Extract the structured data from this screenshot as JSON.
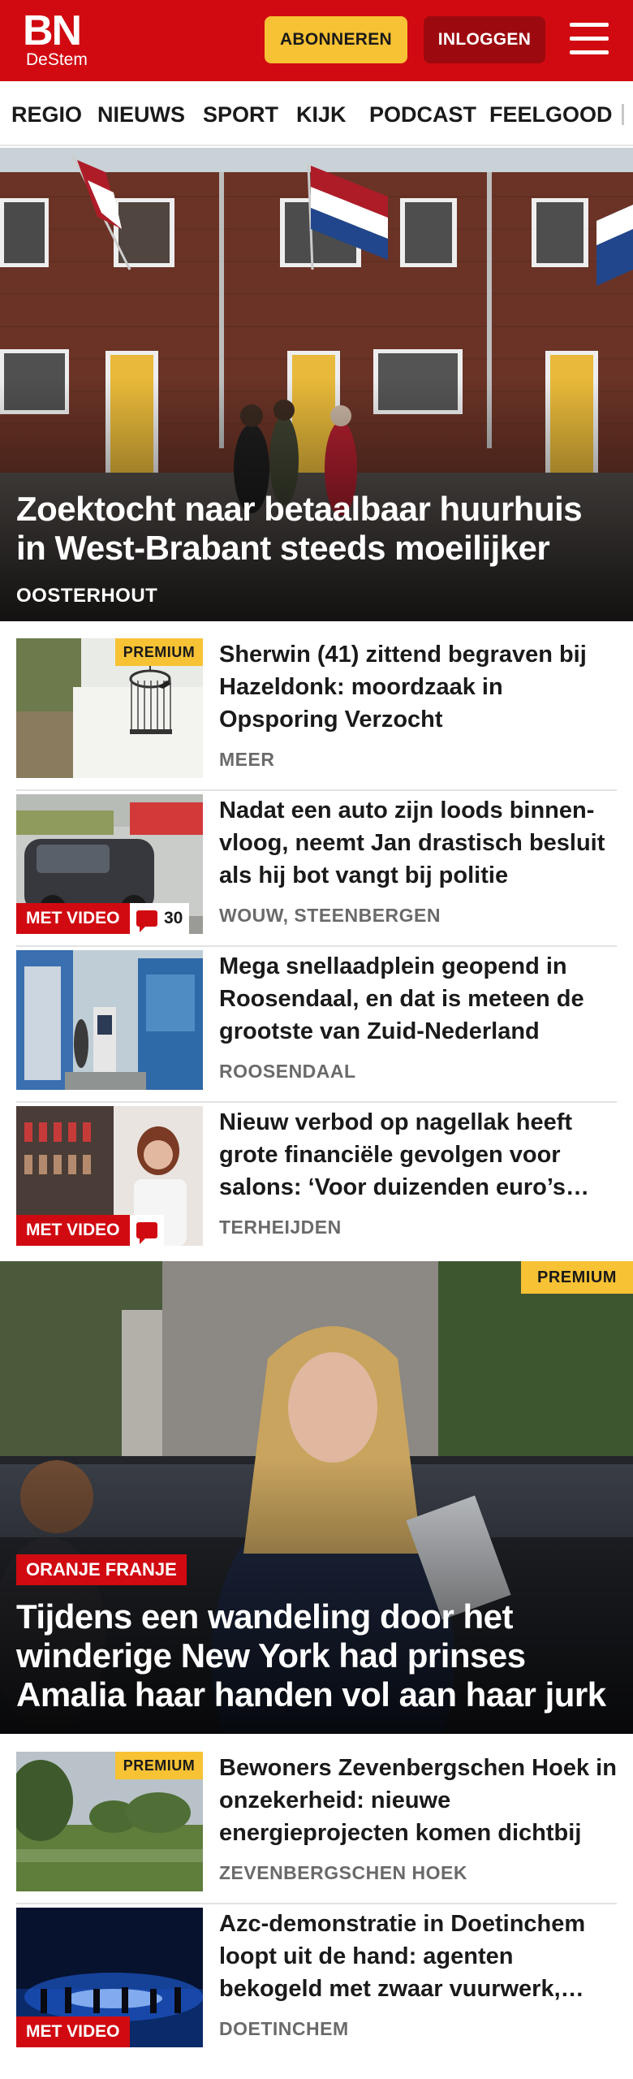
{
  "header": {
    "logo_main": "BN",
    "logo_sub": "DeStem",
    "subscribe_label": "ABONNEREN",
    "login_label": "INLOGGEN",
    "menu_icon": "hamburger-menu-icon",
    "background_color": "#d10a11"
  },
  "nav": {
    "items": [
      {
        "label": "REGIO"
      },
      {
        "label": "NIEUWS"
      },
      {
        "label": "SPORT"
      },
      {
        "label": "KIJK"
      },
      {
        "label": "PODCAST"
      },
      {
        "label": "FEELGOOD"
      }
    ]
  },
  "hero": {
    "title": "Zoektocht naar betaalbaar huurhuis in West-Brabant steeds moeilijker",
    "location": "OOSTERHOUT"
  },
  "articles": [
    {
      "premium_label": "PREMIUM",
      "title": "Sherwin (41) zittend begraven bij Hazeldonk: moordzaak in Opsporing Verzocht",
      "location": "MEER"
    },
    {
      "video_label": "MET VIDEO",
      "comment_count": "30",
      "title": "Nadat een auto zijn loods binnen-vloog, neemt Jan drastisch besluit als hij bot vangt bij politie",
      "location": "WOUW, STEENBERGEN"
    },
    {
      "title": "Mega snellaadplein geopend in Roosendaal, en dat is meteen de grootste van Zuid-Nederland",
      "location": "ROOSENDAAL"
    },
    {
      "video_label": "MET VIDEO",
      "title": "Nieuw verbod op nagellak heeft grote financiële gevolgen voor salons: ‘Voor duizenden euro’s…",
      "location": "TERHEIJDEN"
    }
  ],
  "hero2": {
    "premium_label": "PREMIUM",
    "category": "ORANJE FRANJE",
    "title": "Tijdens een wandeling door het winderige New York had prinses Amalia haar handen vol aan haar jurk"
  },
  "articles2": [
    {
      "premium_label": "PREMIUM",
      "title": "Bewoners Zevenbergschen Hoek in onzekerheid: nieuwe energieprojecten komen dichtbij",
      "location": "ZEVENBERGSCHEN HOEK"
    },
    {
      "video_label": "MET VIDEO",
      "title": "Azc-demonstratie in Doetinchem loopt uit de hand: agenten bekogeld met zwaar vuurwerk,…",
      "location": "DOETINCHEM"
    }
  ],
  "colors": {
    "brand_red": "#d10a11",
    "premium_yellow": "#f7c234",
    "login_dark_red": "#9c0a0f"
  }
}
